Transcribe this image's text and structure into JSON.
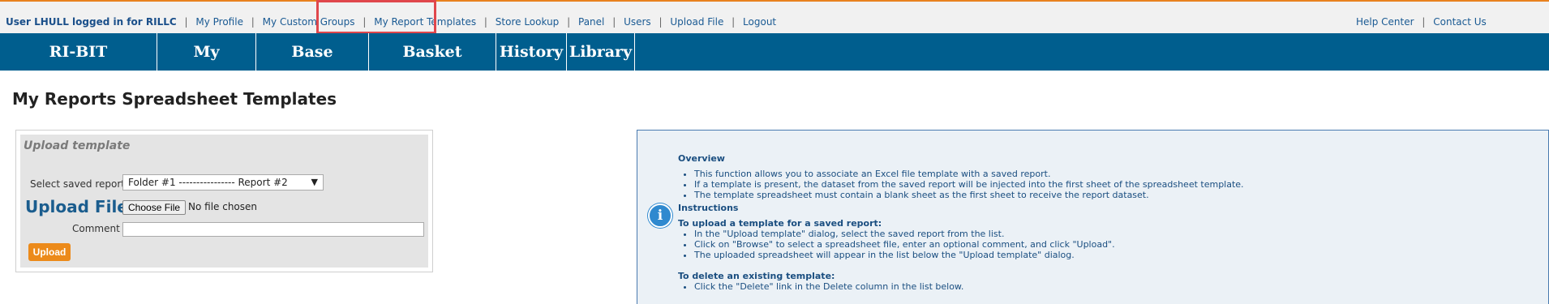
{
  "topbar": {
    "user_status": "User LHULL logged in for RILLC",
    "links": [
      "My Profile",
      "My Custom Groups",
      "My Report Templates",
      "Store Lookup",
      "Panel",
      "Users",
      "Upload File",
      "Logout"
    ],
    "right_links": [
      "Help Center",
      "Contact Us"
    ]
  },
  "nav": {
    "tabs": [
      "RI-BIT Dashboards",
      "My Reports",
      "Base Reports",
      "Basket Reports",
      "History",
      "Library"
    ]
  },
  "page": {
    "title": "My Reports Spreadsheet Templates"
  },
  "upload": {
    "title": "Upload template",
    "select_label": "Select saved report",
    "select_value": "Folder #1 ---------------- Report #2",
    "file_label": "Upload File",
    "choose_button": "Choose File",
    "no_file": "No file chosen",
    "comment_label": "Comment",
    "comment_value": "",
    "upload_button": "Upload"
  },
  "info": {
    "icon_glyph": "i",
    "overview_heading": "Overview",
    "overview_items": [
      "This function allows you to associate an Excel file template with a saved report.",
      "If a template is present, the dataset from the saved report will be injected into the first sheet of the spreadsheet template.",
      "The template spreadsheet must contain a blank sheet as the first sheet to receive the report dataset."
    ],
    "instructions_heading": "Instructions",
    "upload_heading": "To upload a template for a saved report:",
    "upload_items": [
      "In the \"Upload template\" dialog, select the saved report from the list.",
      "Click on \"Browse\" to select a spreadsheet file, enter an optional comment, and click \"Upload\".",
      "The uploaded spreadsheet will appear in the list below the \"Upload template\" dialog."
    ],
    "delete_heading": "To delete an existing template:",
    "delete_items": [
      "Click the \"Delete\" link in the Delete column in the list below."
    ]
  },
  "colors": {
    "nav_bg": "#005e8e",
    "accent_orange": "#ec8a1a",
    "link_blue": "#1a5a93",
    "highlight_red": "#e0474c",
    "info_bg": "#ebf1f6"
  }
}
